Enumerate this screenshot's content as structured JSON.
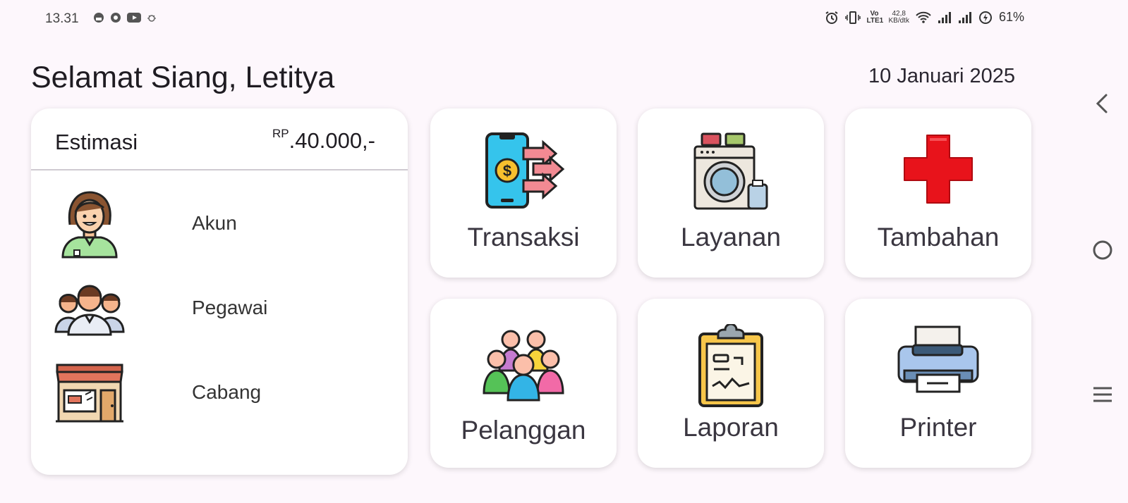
{
  "status_bar": {
    "time": "13.31",
    "net_volte": "Vo LTE1",
    "net_speed_value": "42,8",
    "net_speed_unit": "KB/dtk",
    "battery": "61%"
  },
  "header": {
    "greeting": "Selamat Siang, Letitya",
    "date": "10 Januari 2025"
  },
  "estimate": {
    "label": "Estimasi",
    "currency": "RP",
    "value": ".40.000,-"
  },
  "side_menu": [
    {
      "label": "Akun",
      "icon": "user-woman-icon"
    },
    {
      "label": "Pegawai",
      "icon": "employees-group-icon"
    },
    {
      "label": "Cabang",
      "icon": "store-icon"
    }
  ],
  "tiles": [
    {
      "label": "Transaksi",
      "icon": "mobile-payment-icon"
    },
    {
      "label": "Layanan",
      "icon": "washing-machine-icon"
    },
    {
      "label": "Tambahan",
      "icon": "red-plus-icon"
    },
    {
      "label": "Pelanggan",
      "icon": "customers-group-icon"
    },
    {
      "label": "Laporan",
      "icon": "clipboard-report-icon"
    },
    {
      "label": "Printer",
      "icon": "printer-icon"
    }
  ],
  "colors": {
    "background": "#fdf7fc",
    "card": "#ffffff",
    "plus_red": "#e8131b",
    "phone_cyan": "#35c4ec",
    "arrow_pink": "#f28a93"
  }
}
